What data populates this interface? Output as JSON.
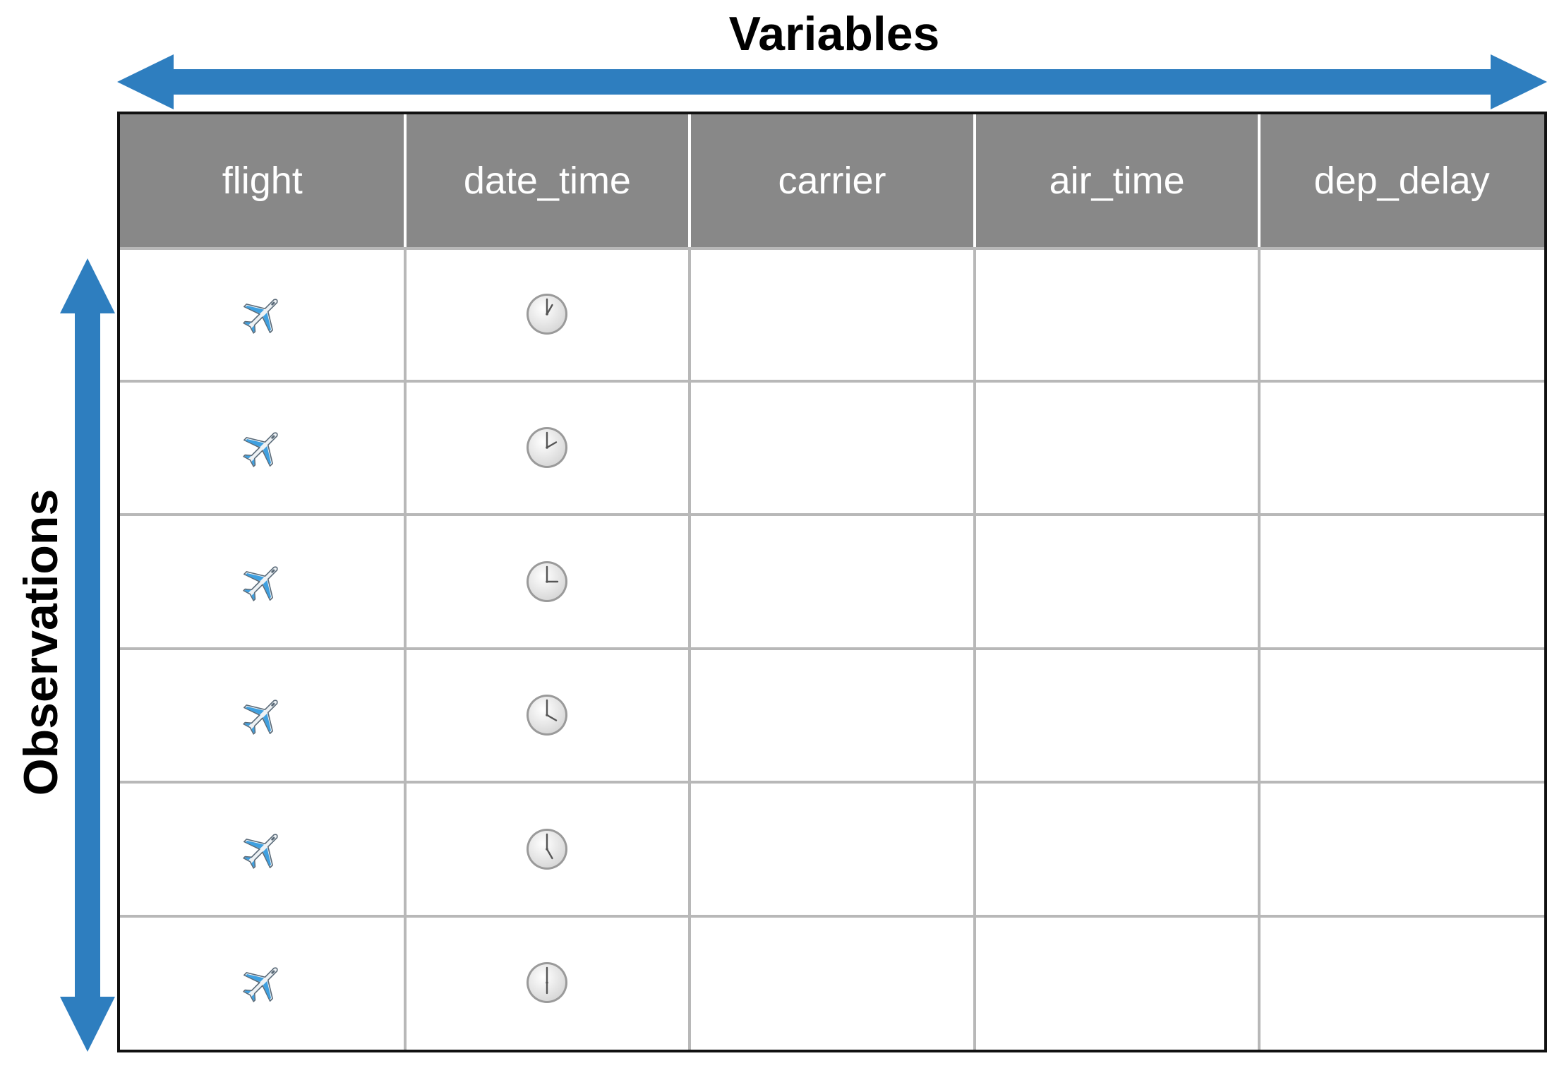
{
  "titles": {
    "variables": "Variables",
    "observations": "Observations"
  },
  "columns": [
    "flight",
    "date_time",
    "carrier",
    "air_time",
    "dep_delay"
  ],
  "rows": [
    {
      "flight_icon": "airplane-icon",
      "clock_icon": "clock-1-oclock-icon",
      "clock_hour": 1
    },
    {
      "flight_icon": "airplane-icon",
      "clock_icon": "clock-2-oclock-icon",
      "clock_hour": 2
    },
    {
      "flight_icon": "airplane-icon",
      "clock_icon": "clock-3-oclock-icon",
      "clock_hour": 3
    },
    {
      "flight_icon": "airplane-icon",
      "clock_icon": "clock-4-oclock-icon",
      "clock_hour": 4
    },
    {
      "flight_icon": "airplane-icon",
      "clock_icon": "clock-5-oclock-icon",
      "clock_hour": 5
    },
    {
      "flight_icon": "airplane-icon",
      "clock_icon": "clock-6-oclock-icon",
      "clock_hour": 6
    }
  ],
  "colors": {
    "arrow": "#2e7ebf",
    "header_bg": "#888888",
    "header_text": "#ffffff",
    "grid_line": "#b8b8b8",
    "border": "#111111"
  }
}
